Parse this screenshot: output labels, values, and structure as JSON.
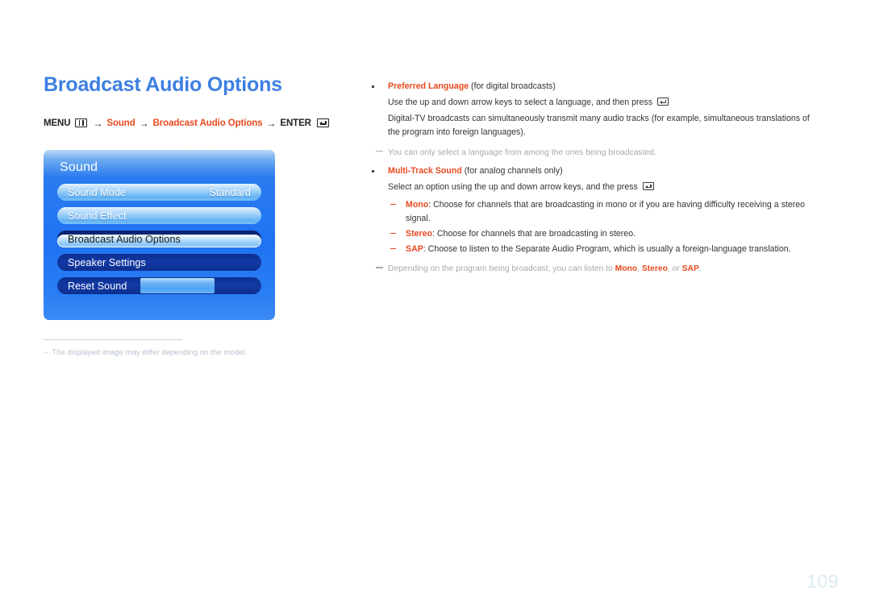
{
  "page": {
    "title": "Broadcast Audio Options",
    "number": "109"
  },
  "breadcrumb": {
    "menu_label": "MENU",
    "menu_icon": "menu-grid-icon",
    "arrow": "→",
    "crumb1": "Sound",
    "crumb2": "Broadcast Audio Options",
    "enter_label": "ENTER",
    "enter_icon": "enter-return-icon"
  },
  "osd": {
    "title": "Sound",
    "rows": [
      {
        "label": "Sound Mode",
        "value": "Standard",
        "state": "light"
      },
      {
        "label": "Sound Effect",
        "value": "",
        "state": "light"
      },
      {
        "label": "Broadcast Audio Options",
        "value": "",
        "state": "selected"
      },
      {
        "label": "Speaker Settings",
        "value": "",
        "state": "dark"
      },
      {
        "label": "Reset Sound",
        "value": "",
        "state": "reset"
      }
    ],
    "colors": {
      "panel_blue": "#1f73f3",
      "row_light": "#8cc7f7",
      "row_dark": "#0d2f8f",
      "selected_highlight": "#a5d3f9"
    }
  },
  "image_note": {
    "dash": "–",
    "text": "The displayed image may differ depending on the model."
  },
  "content": {
    "items": [
      {
        "term": "Preferred Language",
        "term_suffix": " (for digital broadcasts)",
        "lines": [
          "Use the up and down arrow keys to select a language, and then press ",
          "Digital-TV broadcasts can simultaneously transmit many audio tracks (for example, simultaneous translations of the program into foreign languages)."
        ]
      },
      {
        "term": "Multi-Track Sound",
        "term_suffix": " (for analog channels only)",
        "lines": [
          "Select an option using the up and down arrow keys, and the press "
        ]
      }
    ],
    "note1": "You can only select a language from among the ones being broadcasted.",
    "sub_items": [
      {
        "term": "Mono",
        "text": ": Choose for channels that are broadcasting in mono or if you are having difficulty receiving a stereo signal."
      },
      {
        "term": "Stereo",
        "text": ": Choose for channels that are broadcasting in stereo."
      },
      {
        "term": "SAP",
        "text": ": Choose to listen to the Separate Audio Program, which is usually a foreign-language translation."
      }
    ],
    "note2": {
      "prefix": "Depending on the program being broadcast, you can listen to ",
      "t1": "Mono",
      "sep1": ", ",
      "t2": "Stereo",
      "sep2": ", or ",
      "t3": "SAP",
      "suffix": "."
    }
  },
  "colors": {
    "heading_blue": "#3d7fe4",
    "accent_red": "#e8491f",
    "body_text": "#333333",
    "note_gray": "#a9a9a9",
    "page_number": "#dbeaf0"
  }
}
